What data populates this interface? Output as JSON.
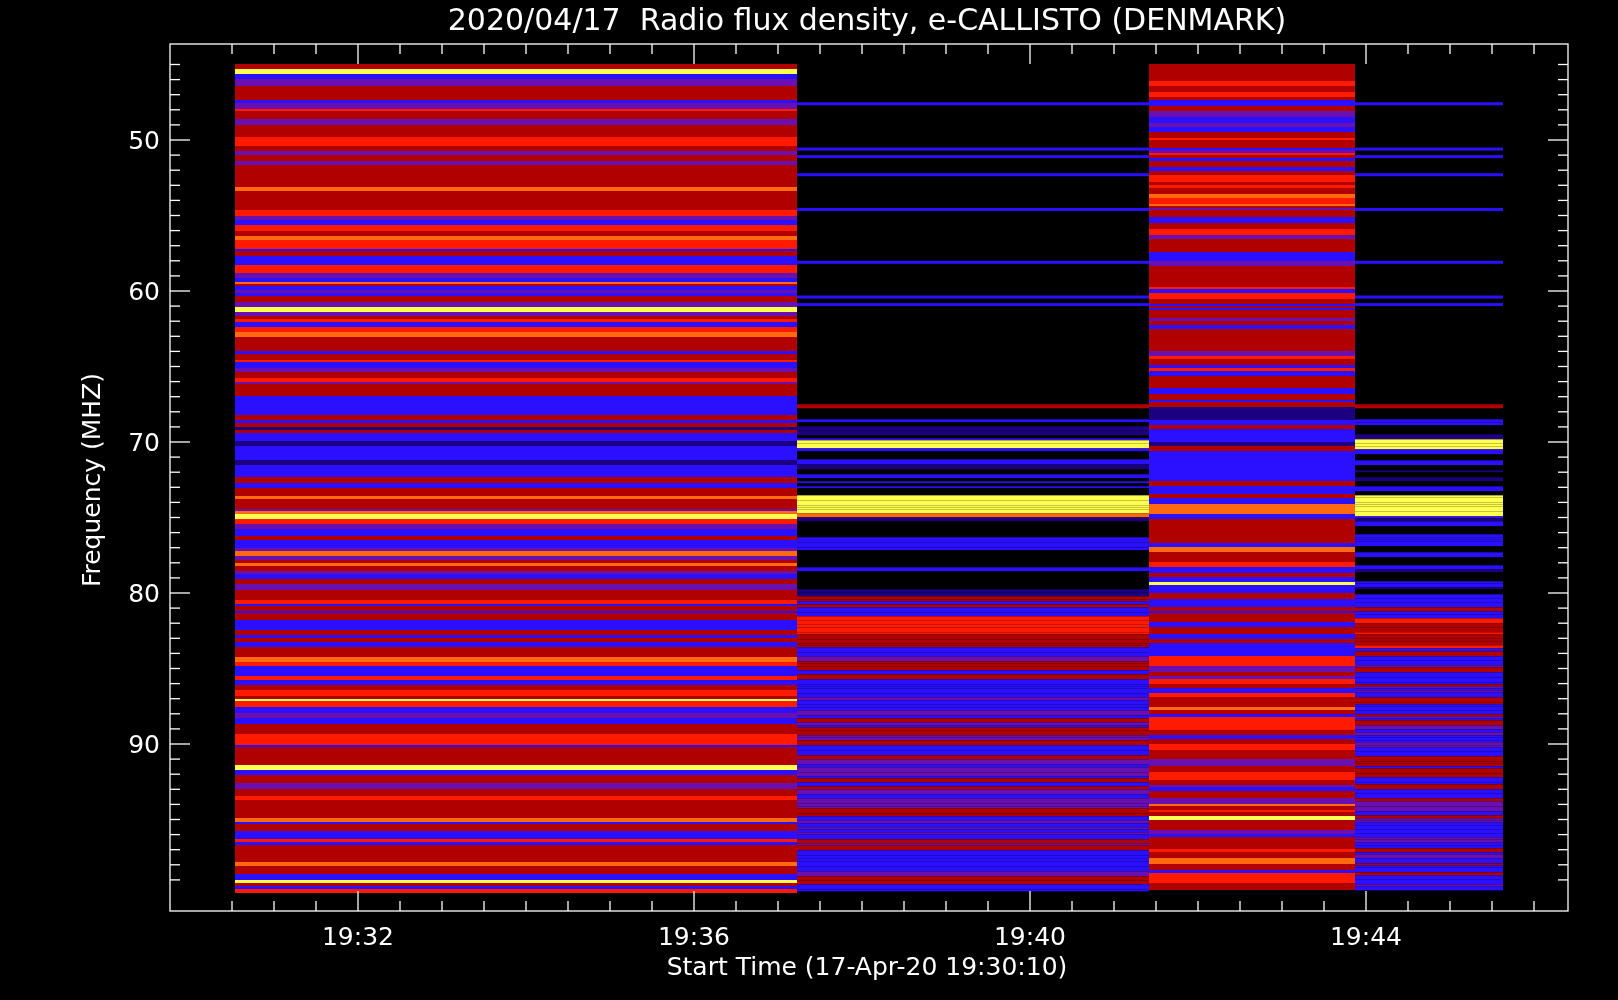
{
  "title": "2020/04/17  Radio flux density, e-CALLISTO (DENMARK)",
  "y_axis": {
    "label": "Frequency (MHZ)",
    "ticks": [
      "50",
      "60",
      "70",
      "80",
      "90"
    ]
  },
  "x_axis": {
    "label": "Start Time (17-Apr-20 19:30:10)",
    "ticks": [
      "19:32",
      "19:36",
      "19:40",
      "19:44"
    ]
  }
}
